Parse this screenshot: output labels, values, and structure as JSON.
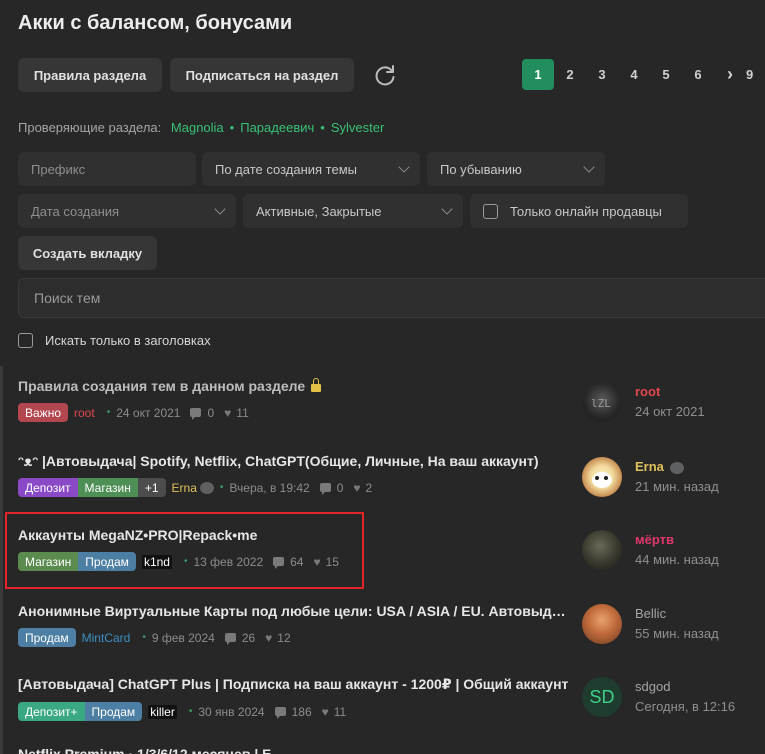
{
  "page_title": "Акки с балансом, бонусами",
  "toolbar": {
    "rules_button": "Правила раздела",
    "subscribe_button": "Подписаться на раздел"
  },
  "pagination": {
    "pages": [
      "1",
      "2",
      "3",
      "4",
      "5",
      "6"
    ],
    "next": "›",
    "last_visible": "9",
    "current": "1"
  },
  "moderators": {
    "label": "Проверяющие раздела:",
    "names": [
      "Magnolia",
      "Парадеевич",
      "Sylvester"
    ]
  },
  "filters": {
    "prefix_placeholder": "Префикс",
    "sort_by": "По дате создания темы",
    "order": "По убыванию",
    "date": "Дата создания",
    "state": "Активные, Закрытые",
    "online_only": "Только онлайн продавцы",
    "create_tab": "Создать вкладку"
  },
  "search": {
    "placeholder": "Поиск тем",
    "titles_only": "Искать только в заголовках"
  },
  "threads": [
    {
      "title": "Правила создания тем в данном разделе",
      "tags": [
        {
          "text": "Важно",
          "color": "#b2474f"
        }
      ],
      "author": "root",
      "author_color": "#e2474c",
      "date": "24 окт 2021",
      "replies": "0",
      "likes": "11",
      "last_user": "root",
      "last_user_color": "#e2474c",
      "last_time": "24 окт 2021"
    },
    {
      "title": "ᵔᴥᵔ  |Автовыдача| Spotify, Netflix, ChatGPT(Общие, Личные, На ваш аккаунт)",
      "tags": [
        {
          "text": "Депозит",
          "color": "#8a4ac7"
        },
        {
          "text": "Магазин",
          "color": "#4e8f56"
        },
        {
          "text": "+1",
          "color": "#4c4c4c"
        }
      ],
      "author": "Erna",
      "author_color": "#e0c25a",
      "date": "Вчера, в 19:42",
      "replies": "0",
      "likes": "2",
      "last_user": "Erna",
      "last_user_color": "#e0c25a",
      "last_time": "21 мин. назад"
    },
    {
      "title": "Аккаунты MegaNZ•PRO|Repack•me",
      "tags": [
        {
          "text": "Магазин",
          "color": "#5b8b4e"
        },
        {
          "text": "Продам",
          "color": "#4d7ea3"
        }
      ],
      "author": "k1nd",
      "author_color": "#ffffff",
      "date": "13 фев 2022",
      "replies": "64",
      "likes": "15",
      "last_user": "мёртв",
      "last_user_color": "#e0386a",
      "last_time": "44 мин. назад"
    },
    {
      "title": "Анонимные Виртуальные Карты под любые цели: USA / ASIA / EU. Автовыдача",
      "tags": [
        {
          "text": "Продам",
          "color": "#4d7ea3"
        }
      ],
      "author": "MintCard",
      "author_color": "#3e8fc2",
      "date": "9 фев 2024",
      "replies": "26",
      "likes": "12",
      "last_user": "Bellic",
      "last_user_color": "#a5a5a5",
      "last_time": "55 мин. назад"
    },
    {
      "title": "[Автовыдача] ChatGPT Plus | Подписка на ваш аккаунт - 1200₽ | Общий аккаунт",
      "tags": [
        {
          "text": "Депозит+",
          "color": "#3aa883"
        },
        {
          "text": "Продам",
          "color": "#4d7ea3"
        }
      ],
      "author": "killer",
      "author_color": "#ffffff",
      "date": "30 янв 2024",
      "replies": "186",
      "likes": "11",
      "last_user": "sdgod",
      "last_user_color": "#a5a5a5",
      "last_time": "Сегодня, в 12:16",
      "avatar_initials": "SD"
    }
  ],
  "cutoff_title": "Netflix Premium · 1/3/6/12 месяцев | Б",
  "colors": {
    "accent": "#228e5d",
    "link_green": "#38c176",
    "highlight": "#e3242b"
  }
}
